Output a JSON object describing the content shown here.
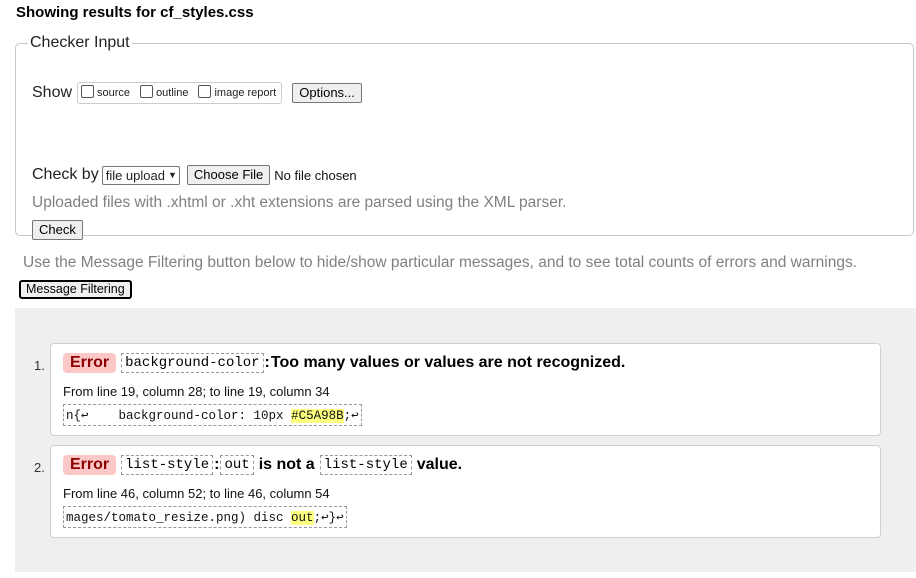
{
  "page": {
    "title": "Showing results for cf_styles.css"
  },
  "checker": {
    "legend": "Checker Input",
    "show_label": "Show",
    "checkboxes": [
      "source",
      "outline",
      "image report"
    ],
    "options_label": "Options...",
    "check_by_label": "Check by",
    "check_by_value": "file upload",
    "choose_file_label": "Choose File",
    "no_file_text": "No file chosen",
    "uploaded_note": "Uploaded files with .xhtml or .xht extensions are parsed using the XML parser.",
    "check_label": "Check"
  },
  "filtering": {
    "note": "Use the Message Filtering button below to hide/show particular messages, and to see total counts of errors and warnings.",
    "button_label": "Message Filtering"
  },
  "messages": [
    {
      "number": "1.",
      "type": "Error",
      "property": "background-color",
      "separator": ":",
      "text": "Too many values or values are not recognized.",
      "location": "From line 19, column 28; to line 19, column 34",
      "extract_before": "n{↩    background-color: 10px ",
      "extract_highlight": "#C5A98B",
      "extract_after": ";↩"
    },
    {
      "number": "2.",
      "type": "Error",
      "property": "list-style",
      "separator": ":",
      "value": "out",
      "text": "is not a",
      "property2": "list-style",
      "text2": "value.",
      "location": "From line 46, column 52; to line 46, column 54",
      "extract_before": "mages/tomato_resize.png) disc ",
      "extract_highlight": "out",
      "extract_after": ";↩}↩"
    }
  ]
}
